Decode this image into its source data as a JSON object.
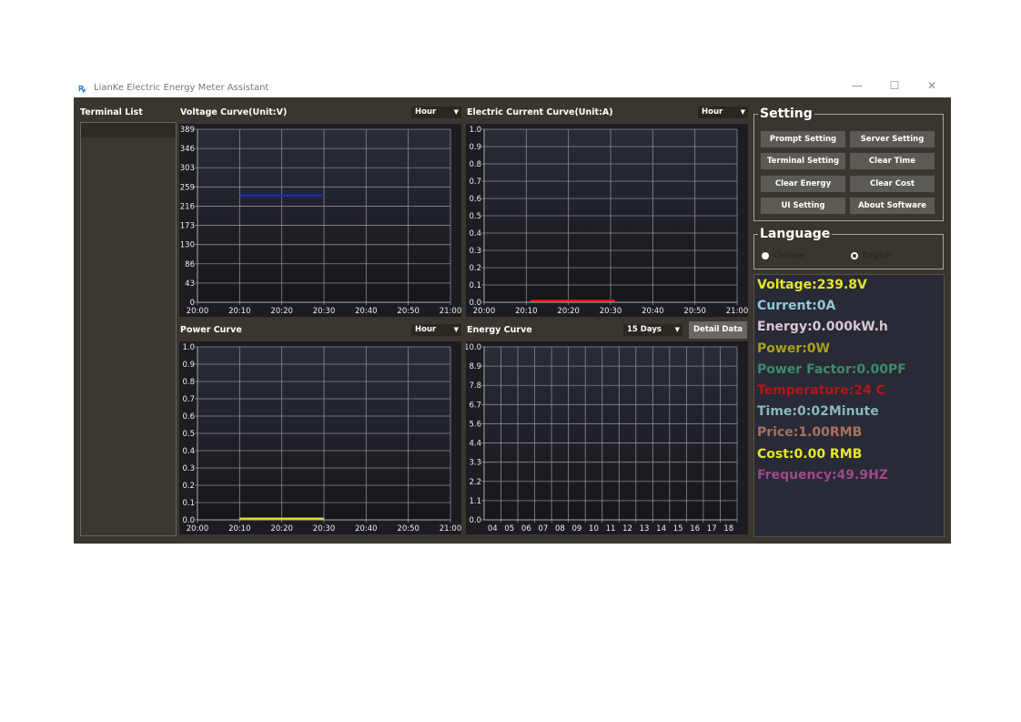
{
  "window": {
    "title": "LianKe Electric Energy Meter Assistant",
    "minimize": "—",
    "maximize": "☐",
    "close": "✕"
  },
  "terminal_list": {
    "label": "Terminal List"
  },
  "charts": {
    "voltage": {
      "title": "Voltage Curve(Unit:V)",
      "range": "Hour"
    },
    "current": {
      "title": "Electric Current Curve(Unit:A)",
      "range": "Hour"
    },
    "power": {
      "title": "Power Curve",
      "range": "Hour"
    },
    "energy": {
      "title": "Energy Curve",
      "range": "15 Days",
      "detail_button": "Detail Data"
    }
  },
  "chart_data": [
    {
      "id": "voltage",
      "type": "line",
      "yticks": [
        "0",
        "43",
        "86",
        "130",
        "173",
        "216",
        "259",
        "303",
        "346",
        "389"
      ],
      "ylim": [
        0,
        389
      ],
      "xticks": [
        "20:00",
        "20:10",
        "20:20",
        "20:30",
        "20:40",
        "20:50",
        "21:00"
      ],
      "xlim": [
        0,
        60
      ],
      "series": [
        {
          "color": "#1a2fd0",
          "x": [
            10,
            30
          ],
          "y": [
            240,
            240
          ]
        }
      ]
    },
    {
      "id": "current",
      "type": "line",
      "yticks": [
        "0.0",
        "0.1",
        "0.2",
        "0.3",
        "0.4",
        "0.5",
        "0.6",
        "0.7",
        "0.8",
        "0.9",
        "1.0"
      ],
      "ylim": [
        0,
        1
      ],
      "xticks": [
        "20:00",
        "20:10",
        "20:20",
        "20:30",
        "20:40",
        "20:50",
        "21:00"
      ],
      "xlim": [
        0,
        60
      ],
      "series": [
        {
          "color": "#e01010",
          "x": [
            11,
            31
          ],
          "y": [
            0.005,
            0.005
          ]
        }
      ]
    },
    {
      "id": "power",
      "type": "line",
      "yticks": [
        "0.0",
        "0.1",
        "0.2",
        "0.3",
        "0.4",
        "0.5",
        "0.6",
        "0.7",
        "0.8",
        "0.9",
        "1.0"
      ],
      "ylim": [
        0,
        1
      ],
      "xticks": [
        "20:00",
        "20:10",
        "20:20",
        "20:30",
        "20:40",
        "20:50",
        "21:00"
      ],
      "xlim": [
        0,
        60
      ],
      "series": [
        {
          "color": "#e8e020",
          "x": [
            10,
            30
          ],
          "y": [
            0.003,
            0.003
          ]
        }
      ]
    },
    {
      "id": "energy",
      "type": "bar",
      "yticks": [
        "0.0",
        "1.1",
        "2.2",
        "3.3",
        "4.4",
        "5.6",
        "6.7",
        "7.8",
        "8.9",
        "10.0"
      ],
      "ylim": [
        0,
        10
      ],
      "categories": [
        "04",
        "05",
        "06",
        "07",
        "08",
        "09",
        "10",
        "11",
        "12",
        "13",
        "14",
        "15",
        "16",
        "17",
        "18"
      ],
      "values": []
    }
  ],
  "settings": {
    "title": "Setting",
    "buttons": [
      "Prompt Setting",
      "Server Setting",
      "Terminal Setting",
      "Clear Time",
      "Clear Energy",
      "Clear Cost",
      "UI Setting",
      "About Software"
    ]
  },
  "language": {
    "title": "Language",
    "options": [
      "Chinese",
      "English"
    ],
    "selected": "Chinese"
  },
  "readouts": [
    {
      "text": "Voltage:239.8V",
      "color": "#e6e62a"
    },
    {
      "text": "Current:0A",
      "color": "#8fc8d8"
    },
    {
      "text": "Energy:0.000kW.h",
      "color": "#d8c8d0"
    },
    {
      "text": "Power:0W",
      "color": "#a8a020"
    },
    {
      "text": "Power Factor:0.00PF",
      "color": "#3f8a68"
    },
    {
      "text": "Temperature:24 C",
      "color": "#b01818"
    },
    {
      "text": "Time:0:02Minute",
      "color": "#8ab8b8"
    },
    {
      "text": "Price:1.00RMB",
      "color": "#a87060"
    },
    {
      "text": "Cost:0.00 RMB",
      "color": "#e6e62a"
    },
    {
      "text": "Frequency:49.9HZ",
      "color": "#a04888"
    }
  ]
}
